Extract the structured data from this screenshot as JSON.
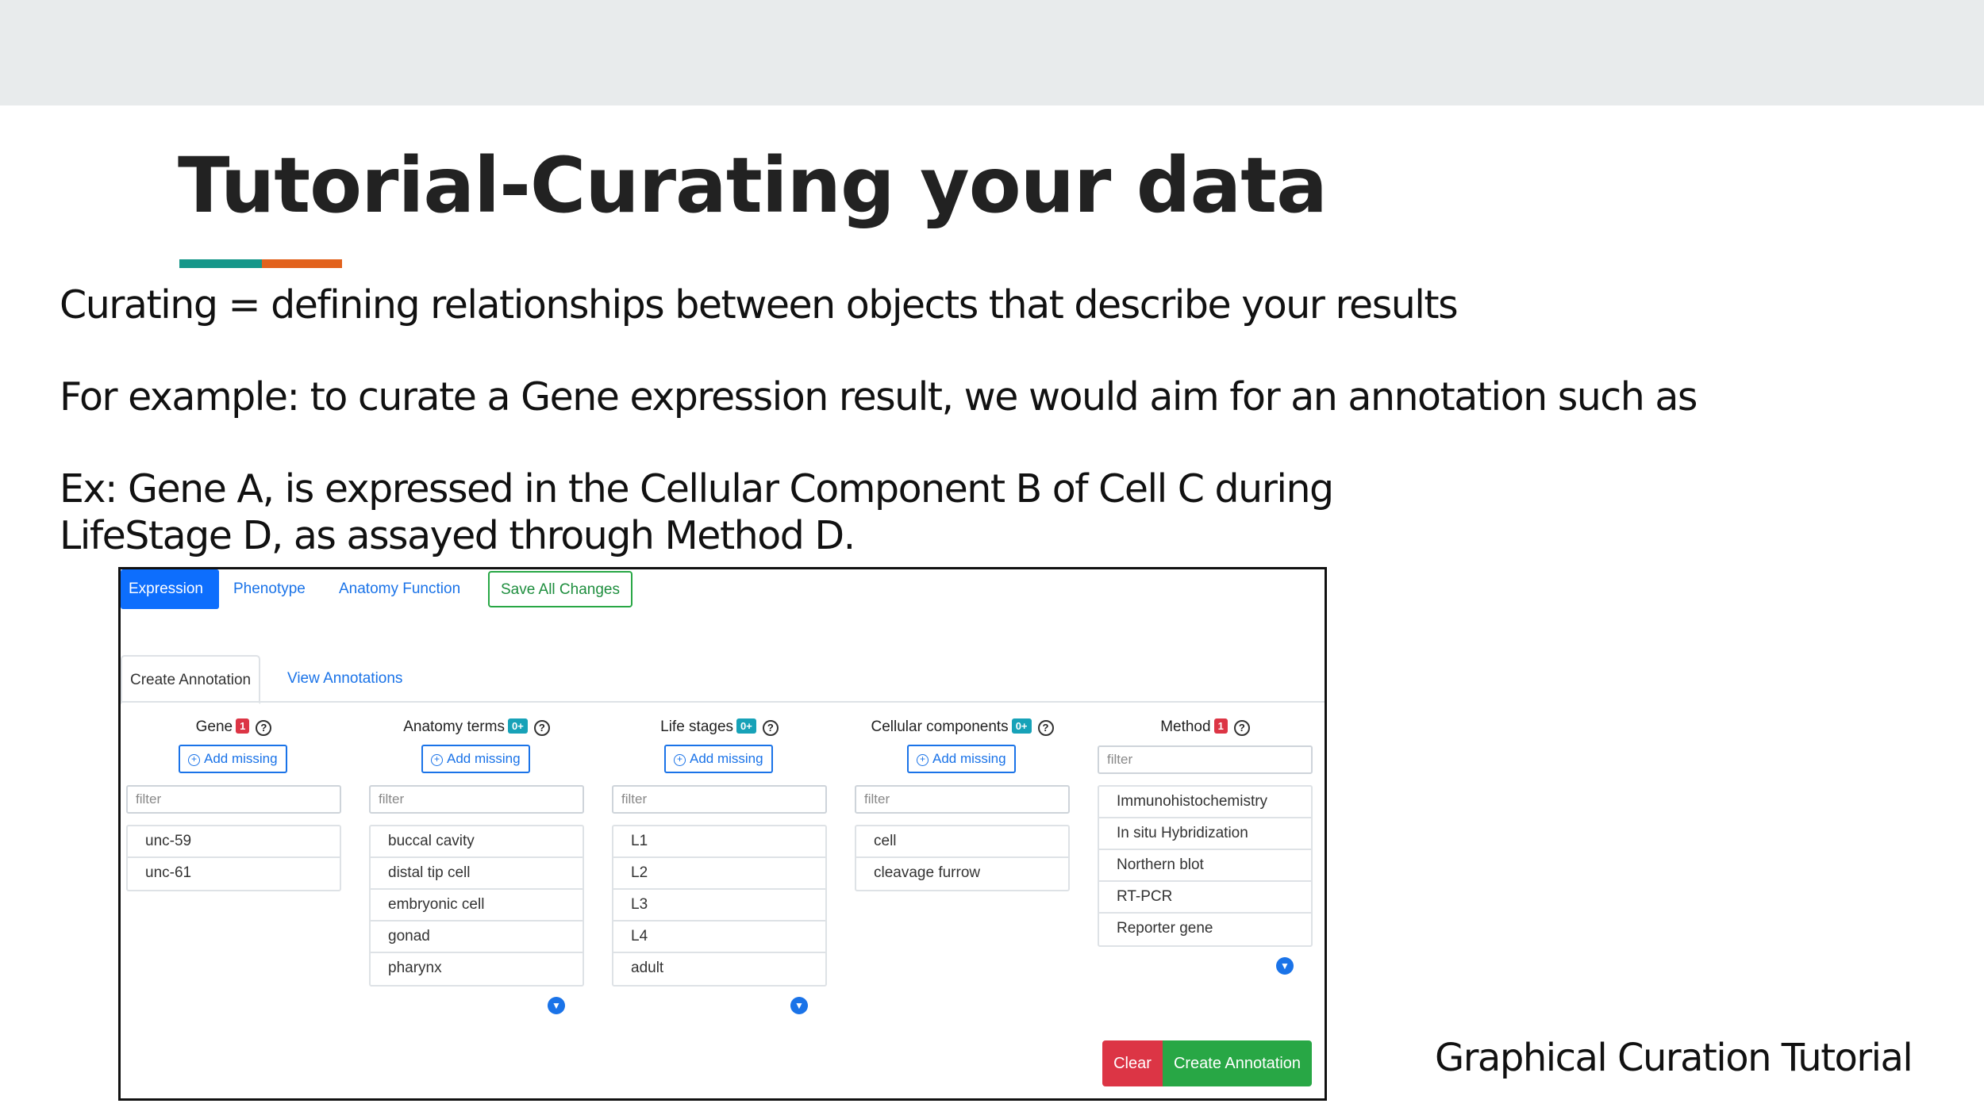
{
  "slide": {
    "title": "Tutorial-Curating your data",
    "line1": "Curating = defining relationships between objects that describe your results",
    "line2": "For example: to curate a Gene expression result, we would aim for an annotation such as",
    "line3": "Ex: Gene A, is expressed in the Cellular Component B of  Cell C during",
    "line4": "LifeStage D, as assayed through Method D.",
    "footer": "Graphical Curation Tutorial",
    "accent_colors": [
      "#16978a",
      "#e2621d"
    ]
  },
  "app": {
    "nav": {
      "expression": "Expression",
      "phenotype": "Phenotype",
      "anatomy_function": "Anatomy Function",
      "save_all": "Save All Changes"
    },
    "subtabs": {
      "create": "Create Annotation",
      "view": "View Annotations"
    },
    "columns": [
      {
        "title": "Gene",
        "badge": "1",
        "add_label": "Add missing",
        "filter_placeholder": "filter",
        "items": [
          "unc-59",
          "unc-61"
        ]
      },
      {
        "title": "Anatomy terms",
        "badge": "0+",
        "add_label": "Add missing",
        "filter_placeholder": "filter",
        "items": [
          "buccal cavity",
          "distal tip cell",
          "embryonic cell",
          "gonad",
          "pharynx"
        ]
      },
      {
        "title": "Life stages",
        "badge": "0+",
        "add_label": "Add missing",
        "filter_placeholder": "filter",
        "items": [
          "L1",
          "L2",
          "L3",
          "L4",
          "adult"
        ]
      },
      {
        "title": "Cellular components",
        "badge": "0+",
        "add_label": "Add missing",
        "filter_placeholder": "filter",
        "items": [
          "cell",
          "cleavage furrow"
        ]
      },
      {
        "title": "Method",
        "badge": "1",
        "filter_placeholder": "filter",
        "items": [
          "Immunohistochemistry",
          "In situ Hybridization",
          "Northern blot",
          "RT-PCR",
          "Reporter gene"
        ]
      }
    ],
    "help_glyph": "?",
    "buttons": {
      "clear": "Clear",
      "create": "Create Annotation"
    },
    "colors": {
      "primary": "#0d6efd",
      "success": "#28a745",
      "danger": "#dc3545",
      "info": "#17a2b8"
    }
  }
}
